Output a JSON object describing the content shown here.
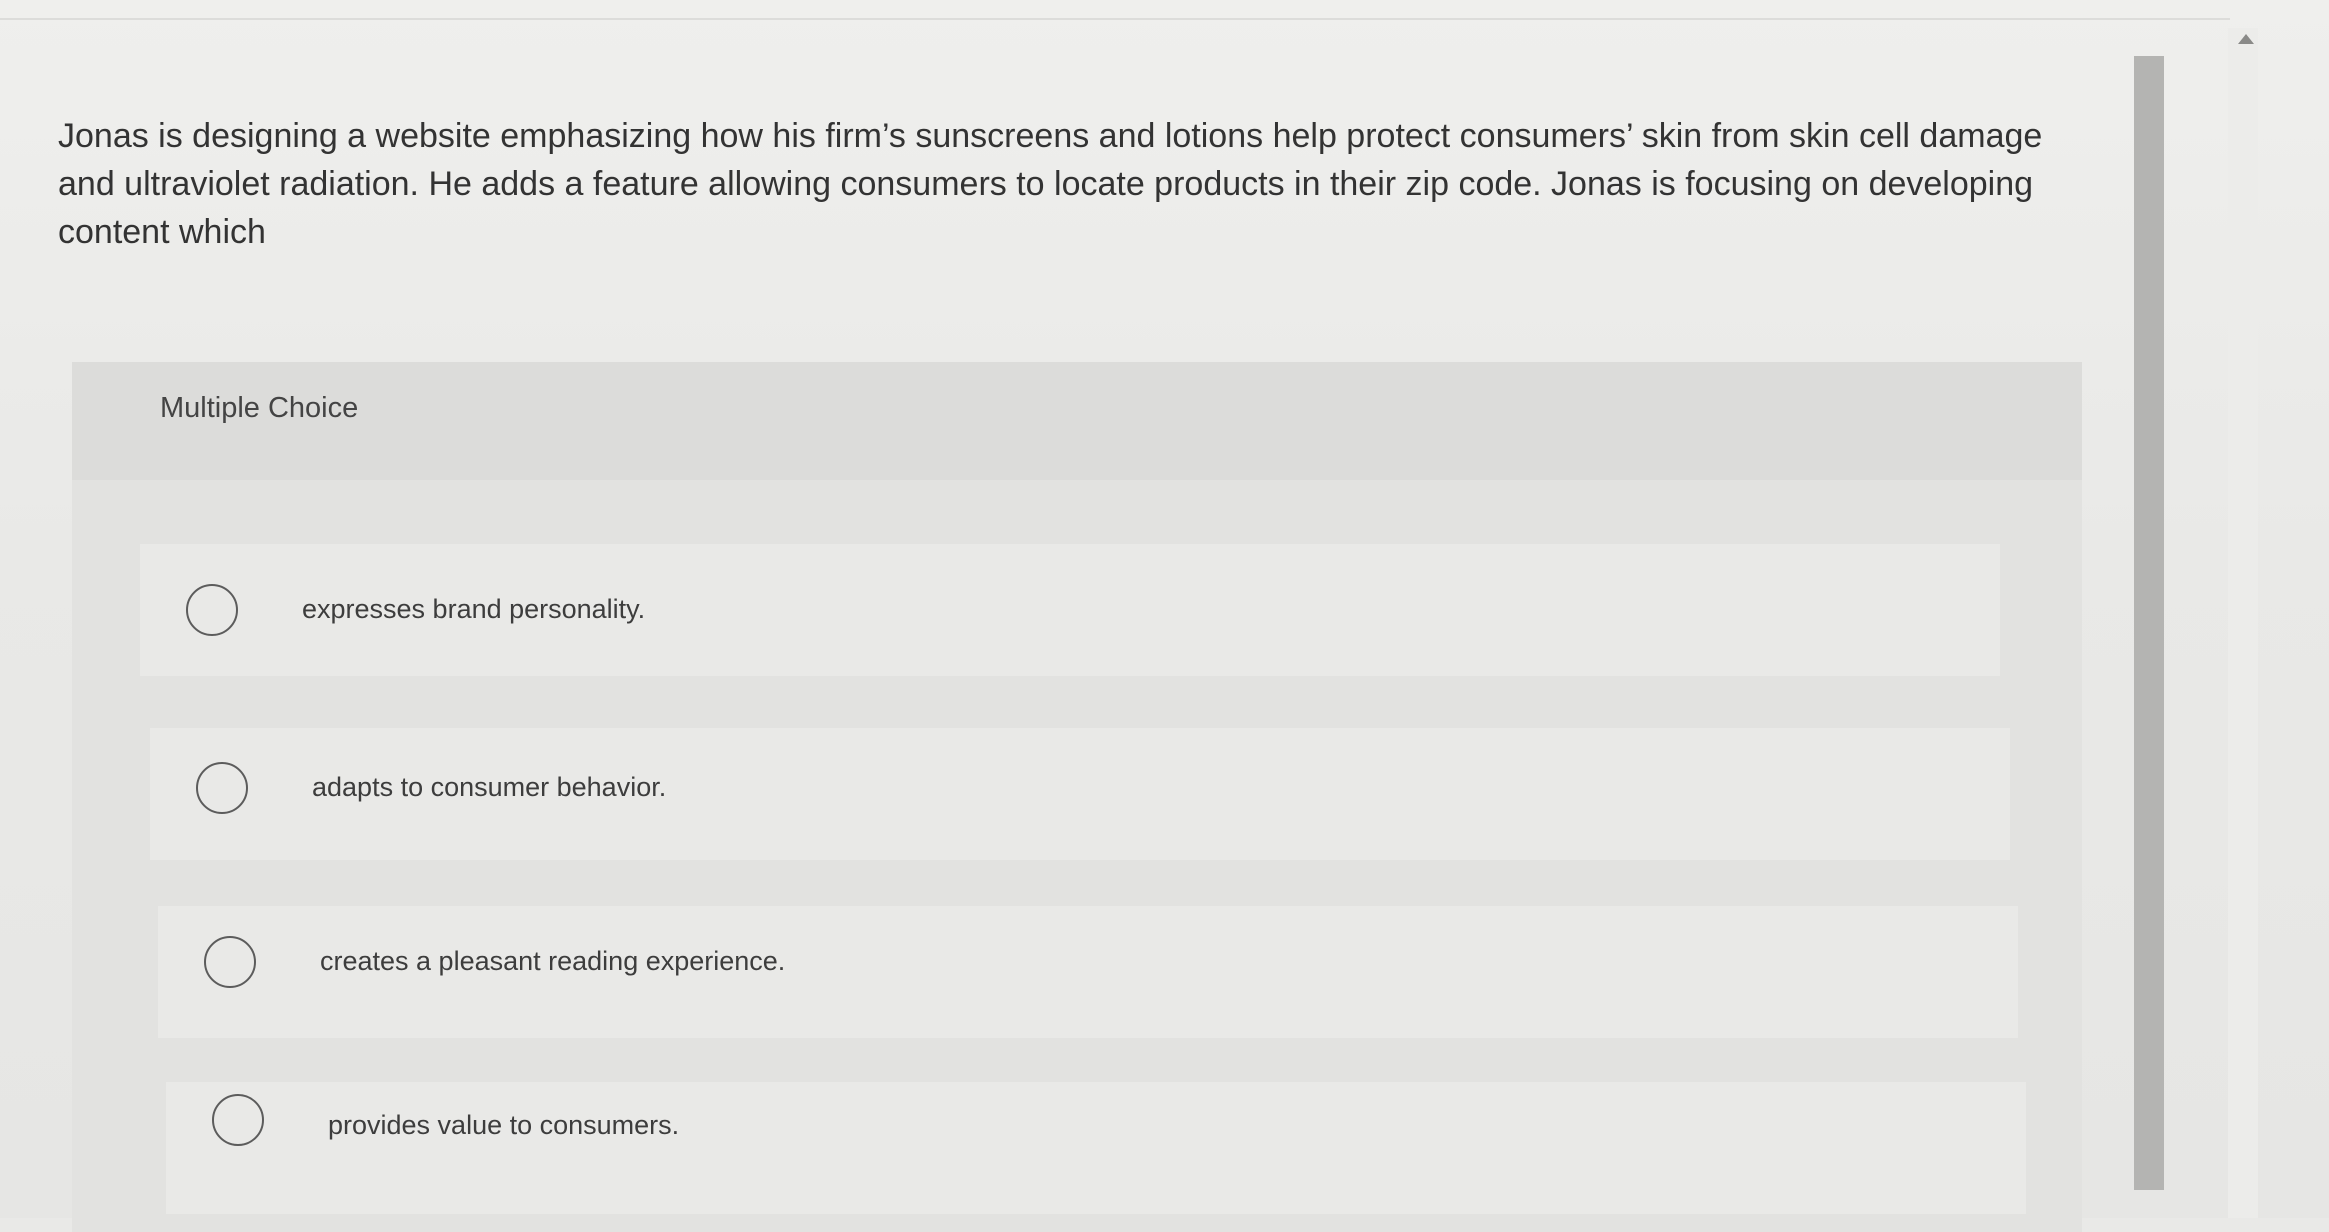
{
  "question": {
    "text": "Jonas is designing a website emphasizing how his firm’s sunscreens and lotions help protect consumers’ skin from skin cell damage and ultraviolet radiation. He adds a feature allowing consumers to locate products in their zip code. Jonas is focusing on developing content which"
  },
  "multiple_choice": {
    "label": "Multiple Choice",
    "options": [
      {
        "text": "expresses brand personality."
      },
      {
        "text": "adapts to consumer behavior."
      },
      {
        "text": "creates a pleasant reading experience."
      },
      {
        "text": "provides value to consumers."
      }
    ]
  },
  "icons": {
    "option_radio": "radio-empty-icon",
    "scroll_up": "triangle-up-icon"
  }
}
